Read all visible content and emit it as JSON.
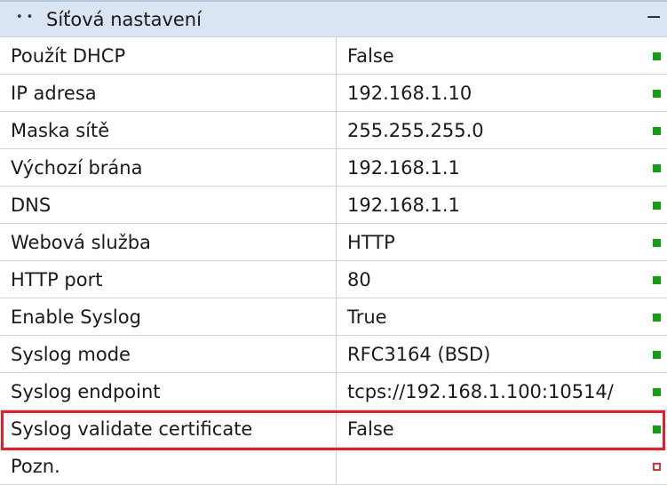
{
  "section": {
    "title": "Síťová nastavení",
    "collapse_glyph": "−"
  },
  "rows": [
    {
      "name": "Použít DHCP",
      "value": "False",
      "status": "ok"
    },
    {
      "name": "IP adresa",
      "value": "192.168.1.10",
      "status": "ok"
    },
    {
      "name": "Maska sítě",
      "value": "255.255.255.0",
      "status": "ok"
    },
    {
      "name": "Výchozí brána",
      "value": "192.168.1.1",
      "status": "ok"
    },
    {
      "name": "DNS",
      "value": "192.168.1.1",
      "status": "ok"
    },
    {
      "name": "Webová služba",
      "value": "HTTP",
      "status": "ok"
    },
    {
      "name": "HTTP port",
      "value": "80",
      "status": "ok"
    },
    {
      "name": "Enable Syslog",
      "value": "True",
      "status": "ok"
    },
    {
      "name": "Syslog mode",
      "value": "RFC3164 (BSD)",
      "status": "ok"
    },
    {
      "name": "Syslog endpoint",
      "value": "tcps://192.168.1.100:10514/",
      "status": "ok"
    },
    {
      "name": "Syslog validate certificate",
      "value": "False",
      "status": "ok",
      "highlighted": true
    },
    {
      "name": "Pozn.",
      "value": "",
      "status": "empty"
    }
  ],
  "colors": {
    "status_ok": "#12a012",
    "status_empty": "#e0313a",
    "highlight": "#e0202c",
    "header_bg": "#dae5f3"
  }
}
